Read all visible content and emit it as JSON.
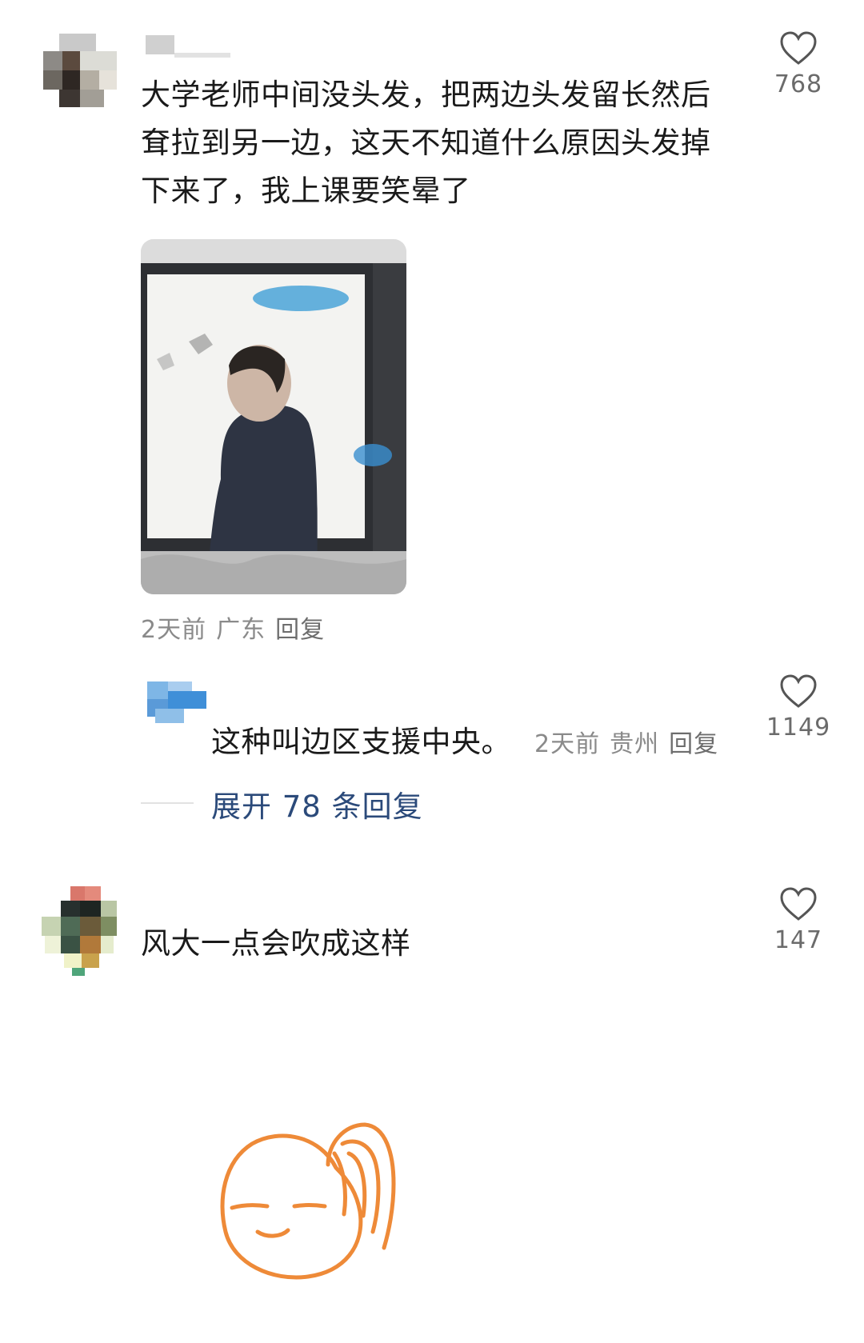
{
  "comments": [
    {
      "text_lines": [
        "大学老师中间没头发，把两边头发留长然后",
        "耷拉到另一边，这天不知道什么原因头发掉",
        "下来了，我上课要笑晕了"
      ],
      "likes": "768",
      "meta": {
        "time": "2天前",
        "location": "广东",
        "reply": "回复"
      }
    },
    {
      "text": "风大一点会吹成这样",
      "likes": "147"
    }
  ],
  "sub_reply": {
    "text": "这种叫边区支援中央。",
    "likes": "1149",
    "meta": {
      "time": "2天前",
      "location": "贵州",
      "reply": "回复"
    }
  },
  "expand_replies": "展开 78 条回复",
  "icons": [
    "heart-icon"
  ],
  "colors": {
    "expand": "#2b4a7a",
    "doodle": "#ee8a38"
  }
}
